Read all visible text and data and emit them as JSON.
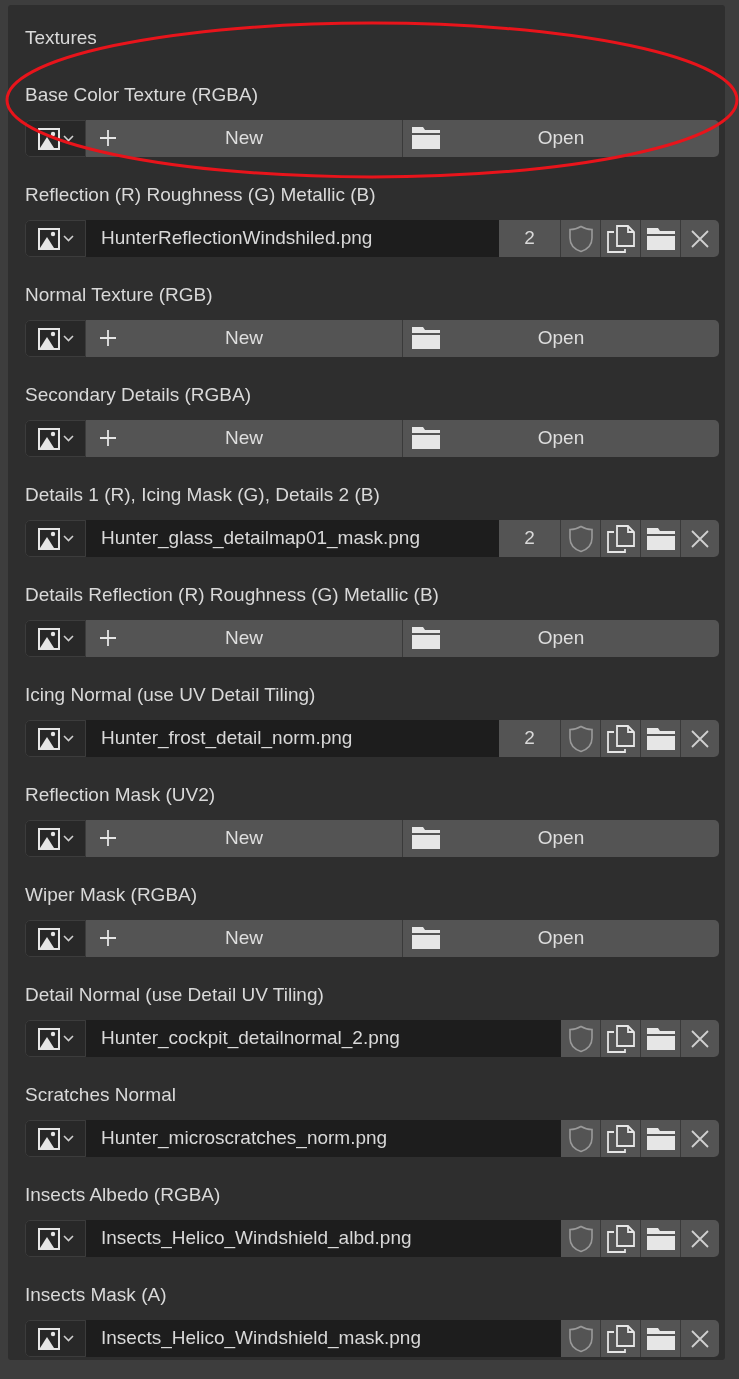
{
  "panel": {
    "title": "Textures"
  },
  "annotation": {
    "kind": "ellipse"
  },
  "slots": [
    {
      "label": "Base Color Texture (RGBA)",
      "kind": "empty",
      "new": "New",
      "open": "Open"
    },
    {
      "label": "Reflection (R) Roughness (G) Metallic (B)",
      "kind": "image",
      "file": "HunterReflectionWindshiled.png",
      "users": "2"
    },
    {
      "label": "Normal Texture (RGB)",
      "kind": "empty",
      "new": "New",
      "open": "Open"
    },
    {
      "label": "Secondary Details (RGBA)",
      "kind": "empty",
      "new": "New",
      "open": "Open"
    },
    {
      "label": "Details 1 (R), Icing Mask (G), Details 2 (B)",
      "kind": "image",
      "file": "Hunter_glass_detailmap01_mask.png",
      "users": "2"
    },
    {
      "label": "Details Reflection (R) Roughness (G) Metallic (B)",
      "kind": "empty",
      "new": "New",
      "open": "Open"
    },
    {
      "label": "Icing Normal (use UV Detail Tiling)",
      "kind": "image",
      "file": "Hunter_frost_detail_norm.png",
      "users": "2"
    },
    {
      "label": "Reflection Mask (UV2)",
      "kind": "empty",
      "new": "New",
      "open": "Open"
    },
    {
      "label": "Wiper Mask (RGBA)",
      "kind": "empty",
      "new": "New",
      "open": "Open"
    },
    {
      "label": "Detail Normal (use Detail UV Tiling)",
      "kind": "image",
      "file": "Hunter_cockpit_detailnormal_2.png"
    },
    {
      "label": "Scratches Normal",
      "kind": "image",
      "file": "Hunter_microscratches_norm.png"
    },
    {
      "label": "Insects Albedo (RGBA)",
      "kind": "image",
      "file": "Insects_Helico_Windshield_albd.png"
    },
    {
      "label": "Insects Mask (A)",
      "kind": "image",
      "file": "Insects_Helico_Windshield_mask.png"
    }
  ]
}
